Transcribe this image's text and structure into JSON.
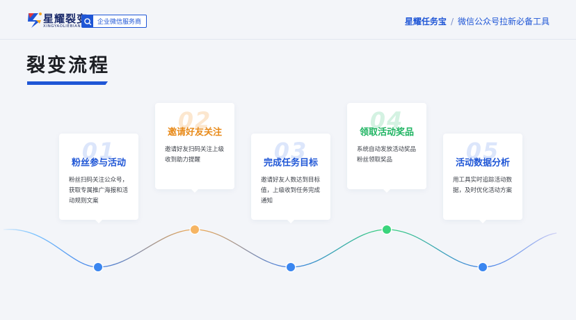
{
  "header": {
    "logo_text": "星耀裂变",
    "logo_sub": "XINGYAOLIEBIAN",
    "badge_text": "企业微信服务商",
    "tagline_brand": "星耀任务宝",
    "tagline_sep": "/",
    "tagline_rest": "微信公众号拉新必备工具"
  },
  "page": {
    "title": "裂变流程"
  },
  "steps": [
    {
      "num": "01",
      "title": "粉丝参与活动",
      "desc": "粉丝扫码关注公众号，获取专属推广海报和活动规则文案",
      "color": "#1f56d6"
    },
    {
      "num": "02",
      "title": "邀请好友关注",
      "desc": "邀请好友扫码关注上级收到助力提醒",
      "color": "#e88b1b"
    },
    {
      "num": "03",
      "title": "完成任务目标",
      "desc": "邀请好友人数达到目标值，上级收到任务完成通知",
      "color": "#1f56d6"
    },
    {
      "num": "04",
      "title": "领取活动奖品",
      "desc": "系统自动发放活动奖品粉丝领取奖品",
      "color": "#1fb462"
    },
    {
      "num": "05",
      "title": "活动数据分析",
      "desc": "用工具实时追踪活动数据，及时优化活动方案",
      "color": "#1f56d6"
    }
  ],
  "colors": {
    "accent": "#1f56d6",
    "orange": "#e88b1b",
    "green": "#1fb462"
  }
}
